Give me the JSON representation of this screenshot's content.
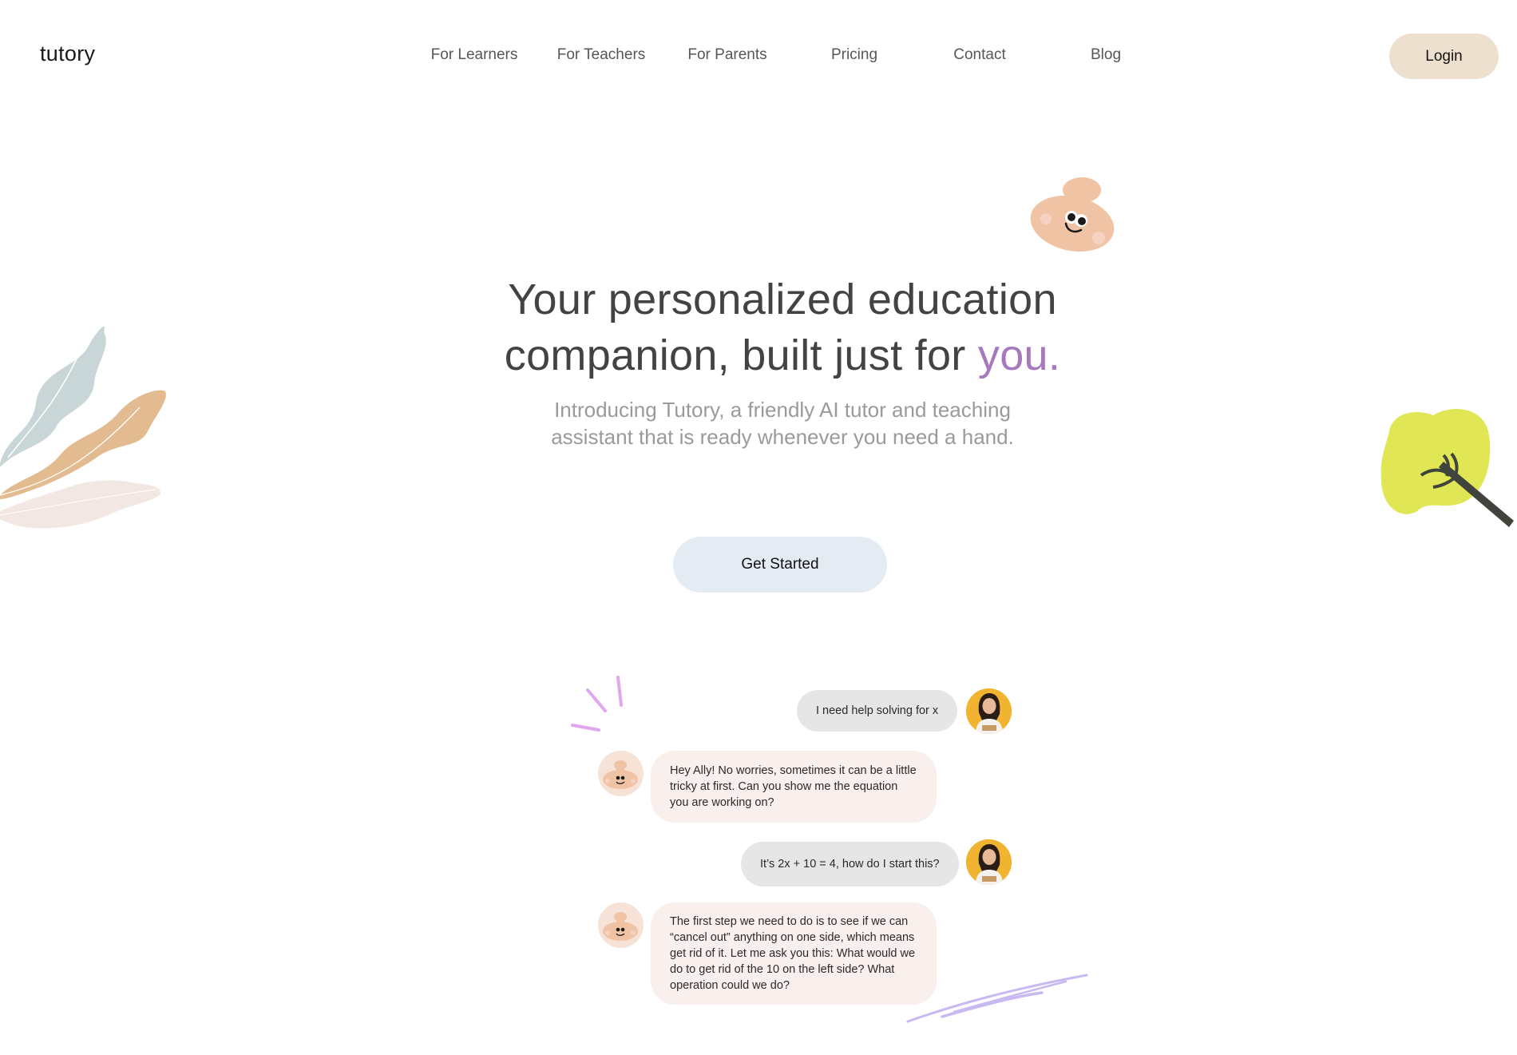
{
  "header": {
    "logo": "tutory",
    "nav": [
      "For Learners",
      "For Teachers",
      "For Parents",
      "Pricing",
      "Contact",
      "Blog"
    ],
    "login_label": "Login"
  },
  "hero": {
    "title_line1": "Your personalized education",
    "title_line2_prefix": "companion, built just for ",
    "title_accent": "you.",
    "subtitle": "Introducing Tutory, a friendly AI tutor and teaching assistant that is ready whenever you need a hand.",
    "cta_label": "Get Started"
  },
  "chat": {
    "messages": [
      {
        "role": "user",
        "text": "I need help solving for x"
      },
      {
        "role": "bot",
        "text": "Hey Ally! No worries, sometimes it can be a little tricky at first. Can you show me the equation you are working on?"
      },
      {
        "role": "user",
        "text": "It’s 2x + 10 = 4, how do I start this?"
      },
      {
        "role": "bot",
        "text": "The first step we need to do is to see if we can “cancel out” anything on one side, which means get rid of it. Let me ask you this: What would we do to get rid of the 10 on the left side? What operation could we do?"
      }
    ]
  },
  "colors": {
    "accent": "#a678be",
    "login_bg": "#eee0cf",
    "cta_bg": "#e4ebf3",
    "user_bubble": "#e6e6e6",
    "bot_bubble": "#f9efec",
    "mascot": "#f0c3a4",
    "tree": "#e1e655"
  }
}
